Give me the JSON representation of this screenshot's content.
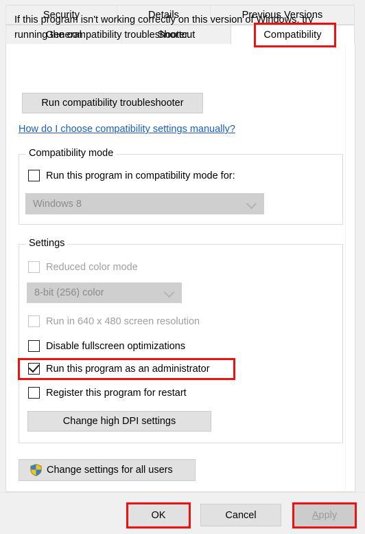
{
  "tabs": {
    "row1": [
      {
        "label": "Security",
        "selected": false
      },
      {
        "label": "Details",
        "selected": false
      },
      {
        "label": "Previous Versions",
        "selected": false
      }
    ],
    "row2": [
      {
        "label": "General",
        "selected": false
      },
      {
        "label": "Shortcut",
        "selected": false
      },
      {
        "label": "Compatibility",
        "selected": true
      }
    ]
  },
  "content": {
    "intro_text": "If this program isn't working correctly on this version of Windows, try running the compatibility troubleshooter.",
    "run_troubleshooter_label": "Run compatibility troubleshooter",
    "help_link_label": "How do I choose compatibility settings manually?"
  },
  "compatibility_mode": {
    "group_title": "Compatibility mode",
    "checkbox_label": "Run this program in compatibility mode for:",
    "checkbox_checked": false,
    "os_selected": "Windows 8",
    "os_disabled": true
  },
  "settings": {
    "group_title": "Settings",
    "reduced_color_label": "Reduced color mode",
    "reduced_color_checked": false,
    "reduced_color_disabled": true,
    "color_depth_selected": "8-bit (256) color",
    "color_depth_disabled": true,
    "low_res_label": "Run in 640 x 480 screen resolution",
    "low_res_checked": false,
    "low_res_disabled": true,
    "disable_fullscreen_label": "Disable fullscreen optimizations",
    "disable_fullscreen_checked": false,
    "run_as_admin_label": "Run this program as an administrator",
    "run_as_admin_checked": true,
    "register_restart_label": "Register this program for restart",
    "register_restart_checked": false,
    "change_dpi_label": "Change high DPI settings"
  },
  "footer": {
    "change_all_users_label": "Change settings for all users",
    "shield_icon": "uac-shield-icon",
    "ok_label": "OK",
    "cancel_label": "Cancel",
    "apply_accel": "A",
    "apply_rest": "pply",
    "apply_disabled": true
  },
  "annotations": {
    "highlight_color": "#ee1111",
    "highlighted": [
      "Compatibility",
      "Run this program as an administrator",
      "OK",
      "Apply"
    ]
  },
  "colors": {
    "dialog_background": "#f0f0f0",
    "page_background": "#ffffff",
    "link_color": "#1c5fbe",
    "button_face": "#e1e1e1",
    "disabled_text": "#a0a0a0"
  }
}
